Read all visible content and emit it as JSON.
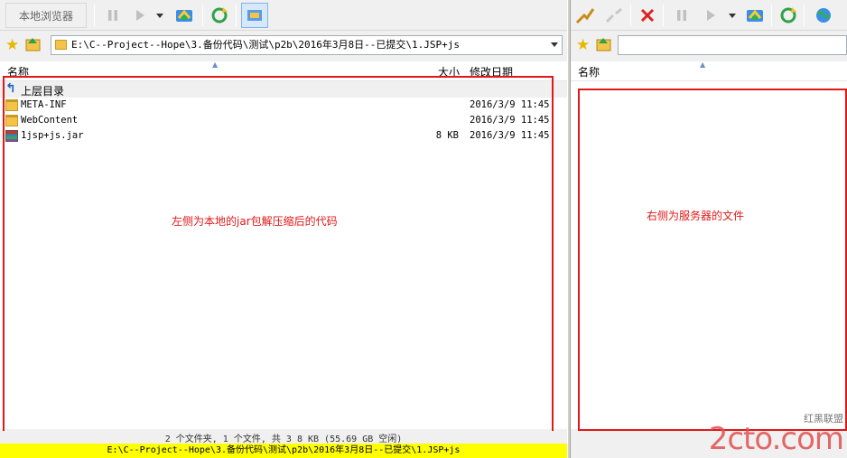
{
  "local": {
    "toolbar": {
      "local_browser_label": "本地浏览器",
      "icons": [
        "pause-icon",
        "play-icon",
        "dropdown-icon",
        "transfer-icon",
        "refresh-icon",
        "local-view-icon"
      ]
    },
    "address": {
      "path": "E:\\C--Project--Hope\\3.备份代码\\测试\\p2b\\2016年3月8日--已提交\\1.JSP+js"
    },
    "columns": {
      "name": "名称",
      "size": "大小",
      "modified": "修改日期"
    },
    "parent_dir_label": "上层目录",
    "files": [
      {
        "name": "META-INF",
        "size": "",
        "date": "2016/3/9 11:45",
        "icon": "folder-icon"
      },
      {
        "name": "WebContent",
        "size": "",
        "date": "2016/3/9 11:45",
        "icon": "folder-icon"
      },
      {
        "name": "1jsp+js.jar",
        "size": "8 KB",
        "date": "2016/3/9 11:45",
        "icon": "archive-icon"
      }
    ],
    "annotation": "左侧为本地的jar包解压缩后的代码",
    "status": "2 个文件夹, 1 个文件, 共 3 8 KB (55.69 GB 空闲)",
    "current_path": "E:\\C--Project--Hope\\3.备份代码\\测试\\p2b\\2016年3月8日--已提交\\1.JSP+js"
  },
  "remote": {
    "toolbar": {
      "icons": [
        "connect-icon",
        "disconnect-icon",
        "stop-icon",
        "pause-icon",
        "play-icon",
        "dropdown-icon",
        "transfer-icon",
        "refresh-icon",
        "globe-icon"
      ]
    },
    "address": {
      "path": ""
    },
    "columns": {
      "name": "名称"
    },
    "annotation": "右侧为服务器的文件"
  },
  "watermark": {
    "top": "红黑联盟",
    "brand": "2cto.com"
  },
  "colors": {
    "annotation": "#e01818",
    "pathbar": "#ffff00"
  }
}
